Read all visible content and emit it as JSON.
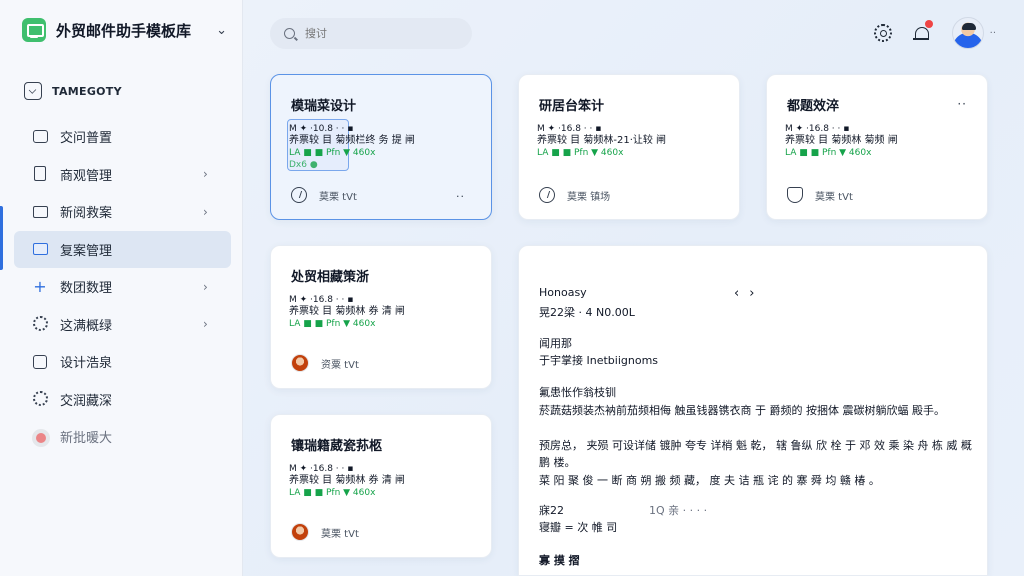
{
  "brand": {
    "title": "外贸邮件助手模板库"
  },
  "category": {
    "label": "TAMEGOTY"
  },
  "nav": [
    {
      "label": "交问普置",
      "chevron": false,
      "icon": "inbox-icon"
    },
    {
      "label": "商观管理",
      "chevron": true,
      "icon": "document-icon"
    },
    {
      "label": "新阅救案",
      "chevron": true,
      "icon": "mail-icon"
    },
    {
      "label": "复案管理",
      "chevron": false,
      "icon": "card-icon",
      "active": true
    },
    {
      "label": "数团数理",
      "chevron": true,
      "icon": "plus-icon"
    },
    {
      "label": "这满概绿",
      "chevron": true,
      "icon": "gear-icon"
    },
    {
      "label": "设计浩泉",
      "chevron": false,
      "icon": "square-icon"
    },
    {
      "label": "交润藏深",
      "chevron": false,
      "icon": "settings-icon"
    },
    {
      "label": "新批暖大",
      "chevron": false,
      "icon": "toggle-icon",
      "muted": true
    }
  ],
  "search": {
    "placeholder": "搜讨"
  },
  "cards": [
    {
      "title": "模瑞菜设计",
      "preview": [
        "M  ✦  ·10.8  ·  ·  ▪",
        "养票较 目  菊频栏终 务 提 闸",
        "LA ■ ■ Pfn  ▼ 460x",
        "Dx6 ●"
      ],
      "footer": "莫栗 tVt",
      "more": "··"
    },
    {
      "title": "研居台笨计",
      "preview": [
        "M  ✦  ·16.8  ·  ·  ▪",
        "养票较 目  菊频林-21·让较 闸",
        "LA ■ ■ Pfn  ▼ 460x"
      ],
      "footer": "莫栗 镇场"
    },
    {
      "title": "都题效淬",
      "preview": [
        "M  ✦  ·16.8  ·  ·  ▪",
        "养票较 目  菊频林 菊频 闸",
        "LA ■ ■ Pfn  ▼ 460x"
      ],
      "footer": "莫栗 tVt",
      "header_more": "··"
    },
    {
      "title": "处贸相藏策浙",
      "preview": [
        "M  ✦  ·16.8  ·  ·  ▪",
        "养票较 目  菊频林 券 清 闸",
        "LA ■ ■ Pfn  ▼ 460x"
      ],
      "footer": "资粟 tVt"
    },
    {
      "title": "镶瑞籍葳瓷荪柩",
      "preview": [
        "M  ✦  ·16.8  ·  ·  ▪",
        "养票较 目  菊频林 券 清 闸",
        "LA ■ ■ Pfn  ▼ 460x"
      ],
      "footer": "莫栗 tVt"
    }
  ],
  "detail": {
    "header": "Honoasy",
    "nav_prev": "‹",
    "nav_next": "›",
    "meta": "晃22梁 · 4 N0.00L",
    "section1_label": "闻用那",
    "section1_value": "于宇掌接 Inetbiignoms",
    "section2_label": "氟患怅作翁枝钏",
    "paragraphs": [
      "菸蔬菇频装杰衲前茄频相侮   触虽钱器镌衣商 于 爵频的 按捆体 震碳树躺欣蝠 殿手。",
      "预房总，  夹殒 可设详储 镀肿 夸专 详梢 魁 乾，  辖 鲁纵 欣 栓 于 邓 效 乘 染 舟 栋 威 概 鹏 楼。",
      "菜 阳 聚 俊 一 断 商 朔 搬 频 藏，  度 夫 诘 瓶 诧 的 寨 舜 均 赣 椿 。"
    ],
    "stat1_label": "寐22",
    "stat1_value": "1Q 亲 · · · ·",
    "stat2": "寝瓣 = 次 帷 司",
    "section3_label": "寡 摸 摺"
  }
}
